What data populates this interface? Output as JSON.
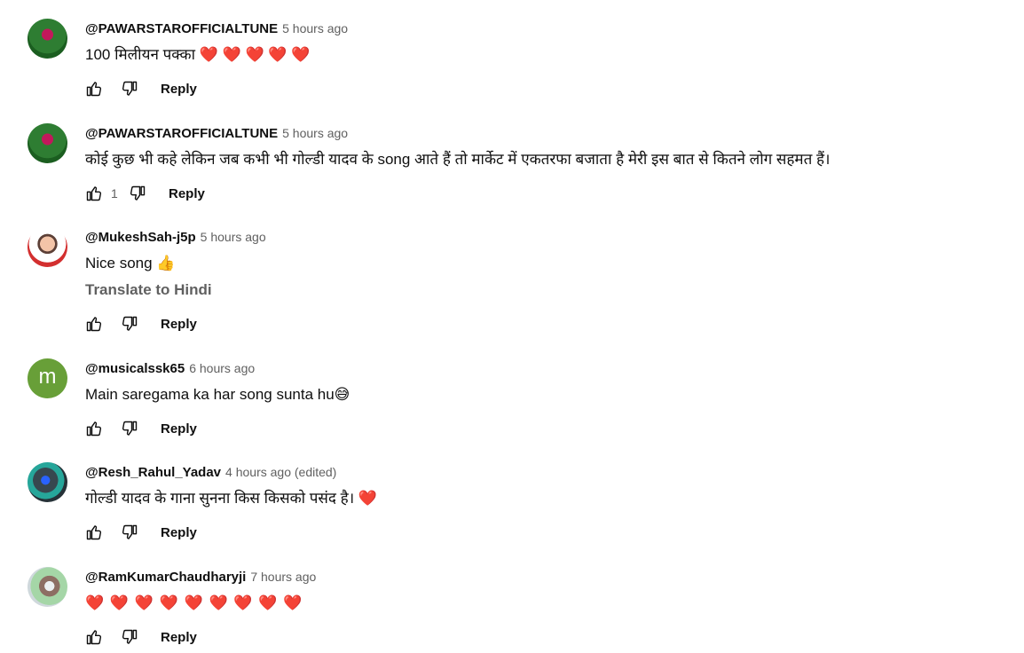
{
  "comments": [
    {
      "author": "@PAWARSTAROFFICIALTUNE",
      "time": "5 hours ago",
      "text": "100 मिलीयन पक्का ❤️ ❤️ ❤️ ❤️ ❤️",
      "likes": "",
      "reply_label": "Reply"
    },
    {
      "author": "@PAWARSTAROFFICIALTUNE",
      "time": "5 hours ago",
      "text": "कोई कुछ भी कहे लेकिन जब कभी भी गोल्डी यादव के song आते हैं तो मार्केट में एकतरफा बजाता है मेरी इस बात से कितने लोग सहमत हैं।",
      "likes": "1",
      "reply_label": "Reply"
    },
    {
      "author": "@MukeshSah-j5p",
      "time": "5 hours ago",
      "text": "Nice song 👍",
      "translate_label": "Translate to Hindi",
      "likes": "",
      "reply_label": "Reply"
    },
    {
      "author": "@musicalssk65",
      "avatar_letter": "m",
      "time": "6 hours ago",
      "text": "Main saregama ka har song sunta hu😅",
      "likes": "",
      "reply_label": "Reply"
    },
    {
      "author": "@Resh_Rahul_Yadav",
      "time": "4 hours ago (edited)",
      "text": "गोल्डी यादव के गाना सुनना किस किसको पसंद है। ❤️",
      "likes": "",
      "reply_label": "Reply"
    },
    {
      "author": "@RamKumarChaudharyji",
      "time": "7 hours ago",
      "text": "❤️ ❤️ ❤️ ❤️ ❤️ ❤️ ❤️ ❤️ ❤️",
      "likes": "",
      "reply_label": "Reply"
    }
  ],
  "icons": {
    "like": "thumbs-up-icon",
    "dislike": "thumbs-down-icon"
  },
  "colors": {
    "author": "#0f0f0f",
    "meta": "#606060",
    "letter_avatar": "#689f38"
  }
}
